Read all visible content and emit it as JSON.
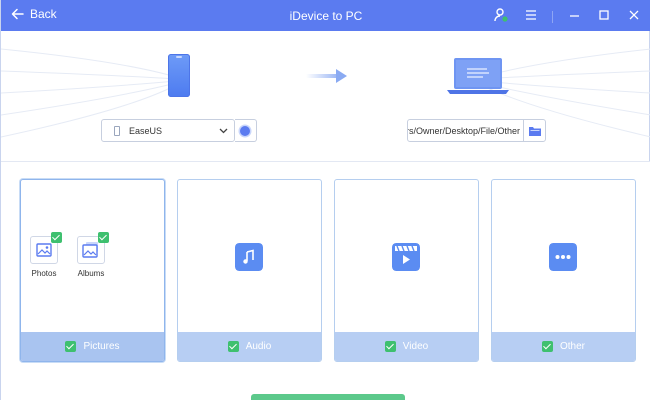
{
  "titlebar": {
    "back_label": "Back",
    "title": "iDevice to PC",
    "icons": [
      "user-status-icon",
      "menu-icon",
      "minimize-icon",
      "maximize-icon",
      "close-icon"
    ]
  },
  "source": {
    "device_name": "EaseUS",
    "icon": "phone-icon"
  },
  "destination": {
    "path": "ers/Owner/Desktop/File/Other",
    "icon": "laptop-icon"
  },
  "categories": [
    {
      "label": "Pictures",
      "checked": true,
      "selected": true,
      "items": [
        {
          "label": "Photos",
          "checked": true
        },
        {
          "label": "Albums",
          "checked": true
        }
      ]
    },
    {
      "label": "Audio",
      "checked": true,
      "icon": "music-icon"
    },
    {
      "label": "Video",
      "checked": true,
      "icon": "video-icon"
    },
    {
      "label": "Other",
      "checked": true,
      "icon": "more-icon"
    }
  ],
  "colors": {
    "accent": "#5b7bf0",
    "card_footer": "#b7cef3",
    "check_green": "#3ec06f",
    "action_button": "#5cc98b"
  }
}
